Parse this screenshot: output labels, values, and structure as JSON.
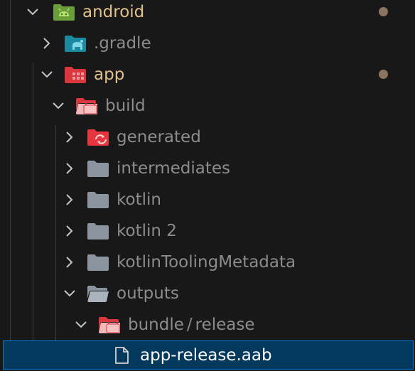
{
  "colors": {
    "background": "#181818",
    "selection": "#04395e",
    "selection_border": "#0078d4",
    "modified_text": "#e2c08d",
    "ignored_text": "#8c8c8c",
    "normal_text": "#cccccc",
    "modified_dot": "#8a7460"
  },
  "tree": {
    "android": {
      "label": "android",
      "icon": "android-folder-icon",
      "expanded": true,
      "modified": true
    },
    "gradle": {
      "label": ".gradle",
      "icon": "gradle-folder-icon",
      "expanded": false
    },
    "app": {
      "label": "app",
      "icon": "app-folder-icon",
      "expanded": true,
      "modified": true
    },
    "build": {
      "label": "build",
      "icon": "build-folder-icon",
      "expanded": true
    },
    "generated": {
      "label": "generated",
      "icon": "generated-folder-icon",
      "expanded": false
    },
    "intermediates": {
      "label": "intermediates",
      "icon": "folder-icon",
      "expanded": false
    },
    "kotlin": {
      "label": "kotlin",
      "icon": "folder-icon",
      "expanded": false
    },
    "kotlin2": {
      "label": "kotlin 2",
      "icon": "folder-icon",
      "expanded": false
    },
    "kotlinToolingMetadata": {
      "label": "kotlinToolingMetadata",
      "icon": "folder-icon",
      "expanded": false
    },
    "outputs": {
      "label": "outputs",
      "icon": "open-folder-icon",
      "expanded": true
    },
    "bundle_release": {
      "label_part1": "bundle",
      "separator": "/",
      "label_part2": "release",
      "icon": "build-folder-icon",
      "expanded": true
    },
    "app_release_aab": {
      "label": "app-release.aab",
      "icon": "file-icon",
      "selected": true
    }
  }
}
